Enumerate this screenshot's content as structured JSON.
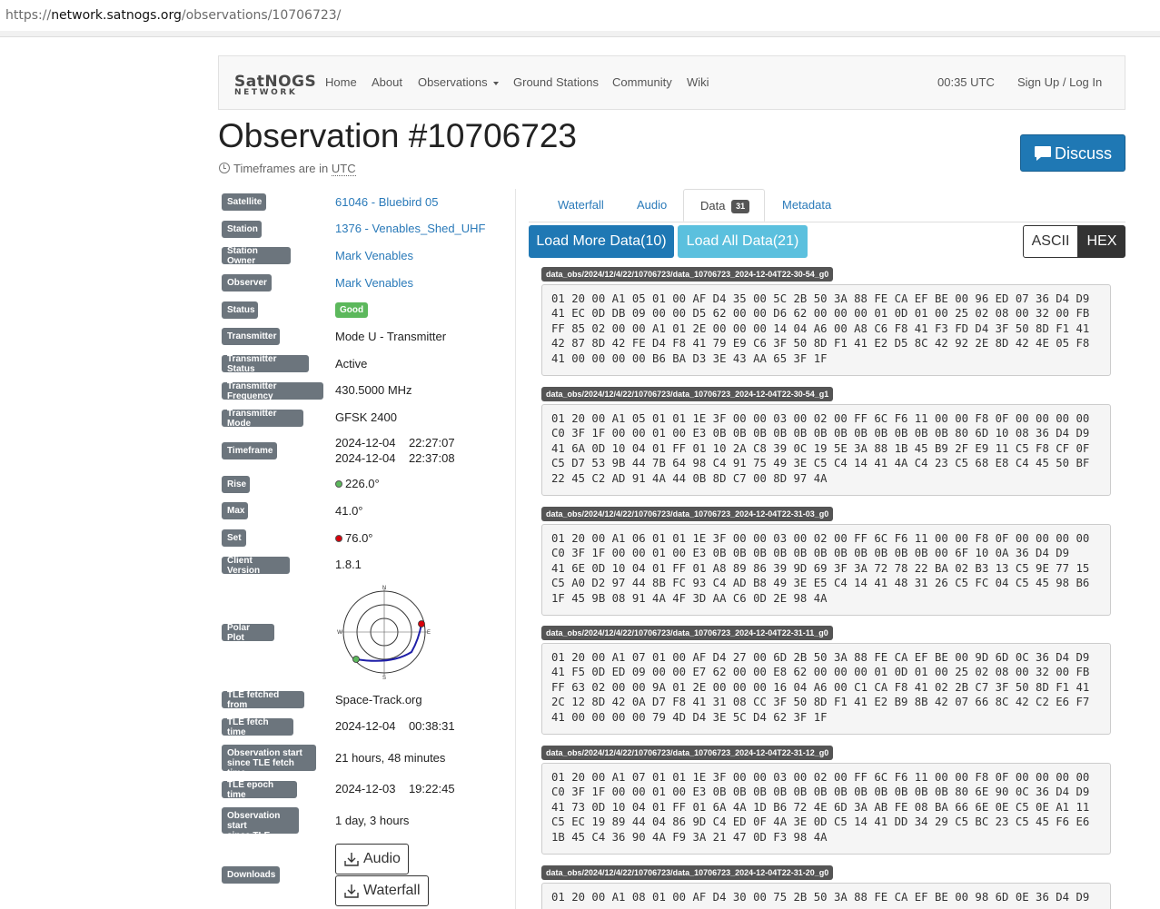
{
  "browser": {
    "url_scheme": "https://",
    "url_host": "network.satnogs.org",
    "url_path": "/observations/10706723/"
  },
  "nav": {
    "logo_top": "SatNOGS",
    "logo_bottom": "NETWORK",
    "items": [
      "Home",
      "About",
      "Observations",
      "Ground Stations",
      "Community",
      "Wiki"
    ],
    "time": "00:35 UTC",
    "signup": "Sign Up / Log In"
  },
  "header": {
    "title": "Observation #10706723",
    "tz_prefix": "Timeframes are in",
    "tz": "UTC",
    "discuss": "Discuss"
  },
  "details": {
    "satellite": {
      "label": "Satellite",
      "value": "61046 - Bluebird 05"
    },
    "station": {
      "label": "Station",
      "value": "1376 - Venables_Shed_UHF"
    },
    "station_owner": {
      "label": "Station Owner",
      "value": "Mark Venables"
    },
    "observer": {
      "label": "Observer",
      "value": "Mark Venables"
    },
    "status": {
      "label": "Status",
      "value": "Good"
    },
    "transmitter": {
      "label": "Transmitter",
      "value": "Mode U - Transmitter"
    },
    "transmitter_status": {
      "label": "Transmitter Status",
      "value": "Active"
    },
    "transmitter_frequency": {
      "label": "Transmitter Frequency",
      "value": "430.5000 MHz"
    },
    "transmitter_mode": {
      "label": "Transmitter Mode",
      "value": "GFSK 2400"
    },
    "timeframe": {
      "label": "Timeframe",
      "start": "2024-12-04    22:27:07",
      "end": "2024-12-04    22:37:08"
    },
    "rise": {
      "label": "Rise",
      "value": "226.0°"
    },
    "max": {
      "label": "Max",
      "value": "41.0°"
    },
    "set": {
      "label": "Set",
      "value": "76.0°"
    },
    "client_version": {
      "label": "Client Version",
      "value": "1.8.1"
    },
    "polar_plot": {
      "label": "Polar Plot",
      "n": "N",
      "e": "E",
      "s": "S",
      "w": "W"
    },
    "tle_source": {
      "label": "TLE fetched from",
      "value": "Space-Track.org"
    },
    "tle_fetch_time": {
      "label": "TLE fetch time",
      "value": "2024-12-04    00:38:31"
    },
    "obs_since_fetch": {
      "label_1": "Observation start",
      "label_2": "since TLE fetch time",
      "value": "21 hours, 48 minutes"
    },
    "tle_epoch": {
      "label": "TLE epoch time",
      "value": "2024-12-03    19:22:45"
    },
    "obs_since_epoch": {
      "label_1": "Observation start",
      "label_2": "since TLE epoch",
      "value": "1 day, 3 hours"
    },
    "downloads": {
      "label": "Downloads",
      "audio": "Audio",
      "waterfall": "Waterfall"
    }
  },
  "colors": {
    "rise_dot": "#5cb85c",
    "set_dot": "#d9000b",
    "primary": "#1f78b4",
    "info": "#5bc0de"
  },
  "tabs": {
    "waterfall": "Waterfall",
    "audio": "Audio",
    "data": "Data",
    "data_count": "31",
    "metadata": "Metadata"
  },
  "data_controls": {
    "load_more": "Load More Data(10)",
    "load_all": "Load All Data(21)",
    "ascii": "ASCII",
    "hex": "HEX"
  },
  "frames": [
    {
      "name": "data_obs/2024/12/4/22/10706723/data_10706723_2024-12-04T22-30-54_g0",
      "hex": "01 20 00 A1 05 01 00 AF D4 35 00 5C 2B 50 3A 88 FE CA EF BE 00 96 ED 07 36 D4 D9\n41 EC 0D DB 09 00 00 D5 62 00 00 D6 62 00 00 00 01 0D 01 00 25 02 08 00 32 00 FB\nFF 85 02 00 00 A1 01 2E 00 00 00 14 04 A6 00 A8 C6 F8 41 F3 FD D4 3F 50 8D F1 41\n42 87 8D 42 FE D4 F8 41 79 E9 C6 3F 50 8D F1 41 E2 D5 8C 42 92 2E 8D 42 4E 05 F8\n41 00 00 00 00 B6 BA D3 3E 43 AA 65 3F 1F"
    },
    {
      "name": "data_obs/2024/12/4/22/10706723/data_10706723_2024-12-04T22-30-54_g1",
      "hex": "01 20 00 A1 05 01 01 1E 3F 00 00 03 00 02 00 FF 6C F6 11 00 00 F8 0F 00 00 00 00\nC0 3F 1F 00 00 01 00 E3 0B 0B 0B 0B 0B 0B 0B 0B 0B 0B 0B 0B 80 6D 10 08 36 D4 D9\n41 6A 0D 10 04 01 FF 01 10 2A C8 39 0C 19 5E 3A 88 1B 45 B9 2F E9 11 C5 F8 CF 0F\nC5 D7 53 9B 44 7B 64 98 C4 91 75 49 3E C5 C4 14 41 4A C4 23 C5 68 E8 C4 45 50 BF\n22 45 C2 AD 91 4A 44 0B 8D C7 00 8D 97 4A"
    },
    {
      "name": "data_obs/2024/12/4/22/10706723/data_10706723_2024-12-04T22-31-03_g0",
      "hex": "01 20 00 A1 06 01 01 1E 3F 00 00 03 00 02 00 FF 6C F6 11 00 00 F8 0F 00 00 00 00\nC0 3F 1F 00 00 01 00 E3 0B 0B 0B 0B 0B 0B 0B 0B 0B 0B 0B 00 6F 10 0A 36 D4 D9\n41 6E 0D 10 04 01 FF 01 A8 89 86 39 9D 69 3F 3A 72 78 22 BA 02 B3 13 C5 9E 77 15\nC5 A0 D2 97 44 8B FC 93 C4 AD B8 49 3E E5 C4 14 41 48 31 26 C5 FC 04 C5 45 98 B6\n1F 45 9B 08 91 4A 4F 3D AA C6 0D 2E 98 4A"
    },
    {
      "name": "data_obs/2024/12/4/22/10706723/data_10706723_2024-12-04T22-31-11_g0",
      "hex": "01 20 00 A1 07 01 00 AF D4 27 00 6D 2B 50 3A 88 FE CA EF BE 00 9D 6D 0C 36 D4 D9\n41 F5 0D ED 09 00 00 E7 62 00 00 E8 62 00 00 00 01 0D 01 00 25 02 08 00 32 00 FB\nFF 63 02 00 00 9A 01 2E 00 00 00 16 04 A6 00 C1 CA F8 41 02 2B C7 3F 50 8D F1 41\n2C 12 8D 42 0A D7 F8 41 31 08 CC 3F 50 8D F1 41 E2 B9 8B 42 07 66 8C 42 C2 E6 F7\n41 00 00 00 00 79 4D D4 3E 5C D4 62 3F 1F"
    },
    {
      "name": "data_obs/2024/12/4/22/10706723/data_10706723_2024-12-04T22-31-12_g0",
      "hex": "01 20 00 A1 07 01 01 1E 3F 00 00 03 00 02 00 FF 6C F6 11 00 00 F8 0F 00 00 00 00\nC0 3F 1F 00 00 01 00 E3 0B 0B 0B 0B 0B 0B 0B 0B 0B 0B 0B 0B 80 6E 90 0C 36 D4 D9\n41 73 0D 10 04 01 FF 01 6A 4A 1D B6 72 4E 6D 3A AB FE 08 BA 66 6E 0E C5 0E A1 11\nC5 EC 19 89 44 04 86 9D C4 ED 0F 4A 3E 0D C5 14 41 DD 34 29 C5 BC 23 C5 45 F6 E6\n1B 45 C4 36 90 4A F9 3A 21 47 0D F3 98 4A"
    },
    {
      "name": "data_obs/2024/12/4/22/10706723/data_10706723_2024-12-04T22-31-20_g0",
      "hex": "01 20 00 A1 08 01 00 AF D4 30 00 75 2B 50 3A 88 FE CA EF BE 00 98 6D 0E 36 D4 D9"
    }
  ]
}
